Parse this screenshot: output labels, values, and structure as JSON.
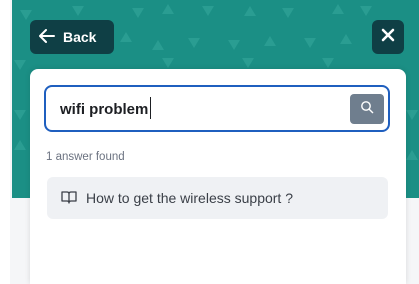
{
  "header": {
    "back_label": "Back",
    "back_icon": "arrow-left-icon",
    "close_icon": "close-icon"
  },
  "search": {
    "value": "wifi problem",
    "icon": "search-icon"
  },
  "results": {
    "count_text": "1 answer found",
    "items": [
      {
        "icon": "book-icon",
        "label": "How to get the wireless support ?"
      }
    ]
  },
  "colors": {
    "header_bg": "#1b8f85",
    "button_bg": "#0f3f45",
    "search_border": "#1f5fbf",
    "search_button": "#6f7e8e",
    "result_bg": "#eff1f4"
  }
}
